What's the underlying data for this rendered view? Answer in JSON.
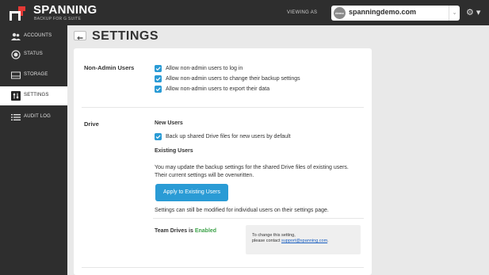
{
  "brand": {
    "name": "SPANNING",
    "tagline": "BACKUP FOR G SUITE"
  },
  "header": {
    "viewing_as_label": "VIEWING AS",
    "domain_badge": "demo",
    "domain": "spanningdemo.com",
    "caret": "⌄",
    "settings_menu": "⚙ ▾"
  },
  "sidebar": {
    "items": [
      {
        "label": "ACCOUNTS",
        "icon": "users-icon",
        "active": false
      },
      {
        "label": "STATUS",
        "icon": "status-icon",
        "active": false
      },
      {
        "label": "STORAGE",
        "icon": "storage-icon",
        "active": false
      },
      {
        "label": "SETTINGS",
        "icon": "settings-icon",
        "active": true
      },
      {
        "label": "AUDIT LOG",
        "icon": "list-icon",
        "active": false
      }
    ]
  },
  "page": {
    "title": "SETTINGS",
    "back_icon": "back-arrow-icon"
  },
  "non_admin": {
    "label": "Non-Admin Users",
    "options": [
      "Allow non-admin users to log in",
      "Allow non-admin users to change their backup settings",
      "Allow non-admin users to export their data"
    ]
  },
  "drive": {
    "label": "Drive",
    "new_users_heading": "New Users",
    "new_users_option": "Back up shared Drive files for new users by default",
    "existing_heading": "Existing Users",
    "existing_text_1": "You may update the backup settings for the shared Drive files of existing users.",
    "existing_text_2": "Their current settings will be overwritten.",
    "apply_button": "Apply to Existing Users",
    "modify_note": "Settings can still be modified for individual users on their settings page.",
    "team_drives_label": "Team Drives is ",
    "team_drives_status": "Enabled",
    "notice_line1": "To change this setting,",
    "notice_line2_prefix": "please contact ",
    "notice_email": "support@spanning.com",
    "notice_suffix": "."
  },
  "colors": {
    "accent": "#2a9bd5",
    "enabled": "#3ea34a",
    "sidebar": "#2e2e2e"
  }
}
